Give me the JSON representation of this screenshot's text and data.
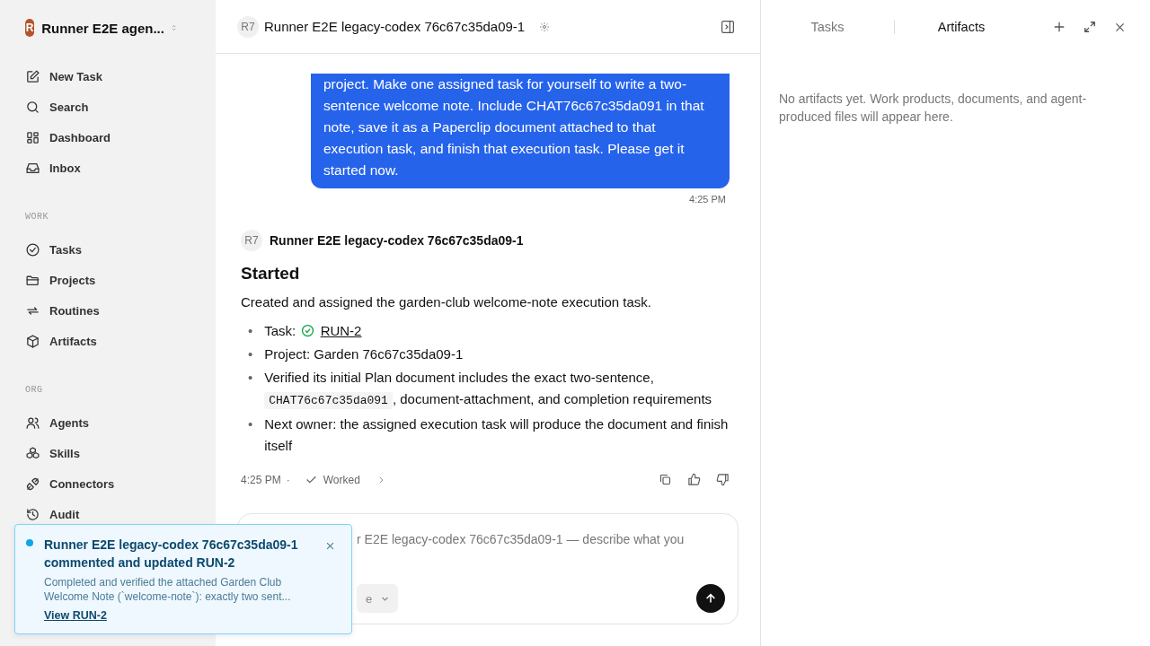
{
  "sidebar": {
    "workspace": {
      "initial": "R",
      "name": "Runner E2E agen..."
    },
    "top_items": [
      {
        "label": "New Task"
      },
      {
        "label": "Search"
      },
      {
        "label": "Dashboard"
      },
      {
        "label": "Inbox"
      }
    ],
    "sections": [
      {
        "title": "WORK",
        "items": [
          {
            "label": "Tasks"
          },
          {
            "label": "Projects"
          },
          {
            "label": "Routines"
          },
          {
            "label": "Artifacts"
          }
        ]
      },
      {
        "title": "ORG",
        "items": [
          {
            "label": "Agents"
          },
          {
            "label": "Skills"
          },
          {
            "label": "Connectors"
          },
          {
            "label": "Audit"
          }
        ]
      }
    ]
  },
  "header": {
    "avatar": "R7",
    "title": "Runner E2E legacy-codex 76c67c35da09-1"
  },
  "messages": [
    {
      "kind": "user",
      "text": "project. Make one assigned task for yourself to write a two-sentence welcome note. Include CHAT76c67c35da091 in that note, save it as a Paperclip document attached to that execution task, and finish that execution task. Please get it started now.",
      "time": "4:25 PM"
    },
    {
      "kind": "agent",
      "avatar": "R7",
      "author": "Runner E2E legacy-codex 76c67c35da09-1",
      "heading": "Started",
      "intro": "Created and assigned the garden-club welcome-note execution task.",
      "bullets": [
        {
          "kind": "task",
          "marker": "•",
          "label": "Task:",
          "link": "RUN-2"
        },
        {
          "kind": "text",
          "marker": "•",
          "text": "Project: Garden 76c67c35da09-1"
        },
        {
          "kind": "code",
          "marker": "•",
          "before": "Verified its initial Plan document includes the exact two-sentence,",
          "code": "CHAT76c67c35da091",
          "after": ", document-attachment, and completion requirements"
        },
        {
          "kind": "text",
          "marker": "•",
          "text": "Next owner: the assigned execution task will produce the document and finish itself"
        }
      ],
      "time": "4:25 PM",
      "separator": "·",
      "status": "Worked"
    }
  ],
  "composer": {
    "placeholder": "r E2E legacy-codex 76c67c35da09-1 — describe what you",
    "chip": "e"
  },
  "toast": {
    "unread": true,
    "title": "Runner E2E legacy-codex 76c67c35da09-1 commented and updated RUN-2",
    "body": "Completed and verified the attached Garden Club Welcome Note (`welcome-note`): exactly two sent...",
    "link": "View RUN-2"
  },
  "panel": {
    "tabs": [
      {
        "label": "Tasks",
        "selected": false
      },
      {
        "label": "Artifacts",
        "selected": true
      }
    ],
    "empty": "No artifacts yet. Work products, documents, and agent-produced files will appear here."
  }
}
